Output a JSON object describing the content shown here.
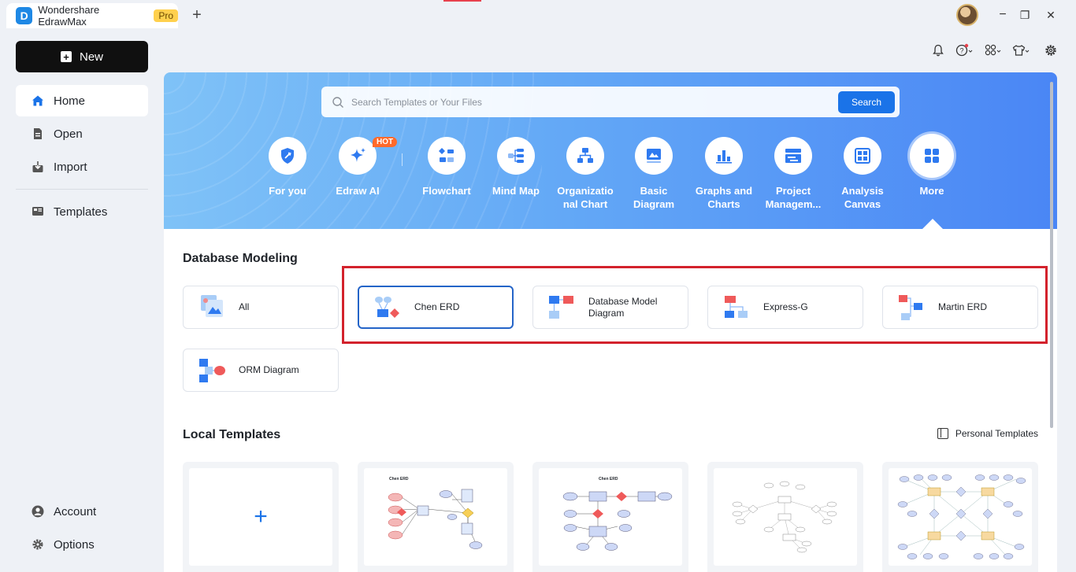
{
  "titlebar": {
    "app_logo": "D",
    "app_name": "Wondershare EdrawMax",
    "pro_badge": "Pro",
    "new_tab": "+",
    "window_controls": {
      "minimize": "−",
      "restore": "❐",
      "close": "✕"
    }
  },
  "sidebar": {
    "new_label": "New",
    "items": [
      {
        "label": "Home",
        "icon": "home-icon",
        "active": true
      },
      {
        "label": "Open",
        "icon": "file-icon"
      },
      {
        "label": "Import",
        "icon": "import-icon"
      },
      {
        "label": "Templates",
        "icon": "templates-icon"
      }
    ],
    "bottom_items": [
      {
        "label": "Account",
        "icon": "account-icon"
      },
      {
        "label": "Options",
        "icon": "gear-icon"
      }
    ]
  },
  "toolbar": {
    "icons": [
      "bell-icon",
      "help-icon",
      "apps-icon",
      "shirt-icon",
      "settings-icon"
    ]
  },
  "search": {
    "placeholder": "Search Templates or Your Files",
    "button_label": "Search"
  },
  "categories": [
    {
      "label": "For you",
      "icon": "for-you-icon"
    },
    {
      "label": "Edraw AI",
      "icon": "edraw-ai-icon",
      "badge": "HOT"
    },
    {
      "label": "Flowchart",
      "icon": "flowchart-icon"
    },
    {
      "label": "Mind Map",
      "icon": "mind-map-icon"
    },
    {
      "label": "Organizatio nal Chart",
      "icon": "org-chart-icon"
    },
    {
      "label": "Basic Diagram",
      "icon": "basic-diagram-icon"
    },
    {
      "label": "Graphs and Charts",
      "icon": "graphs-icon"
    },
    {
      "label": "Project Managem...",
      "icon": "project-icon"
    },
    {
      "label": "Analysis Canvas",
      "icon": "analysis-icon"
    },
    {
      "label": "More",
      "icon": "more-icon",
      "active": true
    }
  ],
  "database_modeling": {
    "title": "Database Modeling",
    "types": [
      {
        "label": "All"
      },
      {
        "label": "Chen ERD",
        "selected": true
      },
      {
        "label": "Database Model Diagram"
      },
      {
        "label": "Express-G"
      },
      {
        "label": "Martin ERD"
      },
      {
        "label": "ORM Diagram"
      }
    ]
  },
  "local_templates": {
    "title": "Local Templates",
    "personal_label": "Personal Templates",
    "blank_symbol": "+",
    "thumb_titles": [
      "Chen ERD",
      "Chen ERD"
    ]
  },
  "colors": {
    "accent": "#1a73e8",
    "highlight": "#d3222c",
    "selected_border": "#2464c8"
  }
}
